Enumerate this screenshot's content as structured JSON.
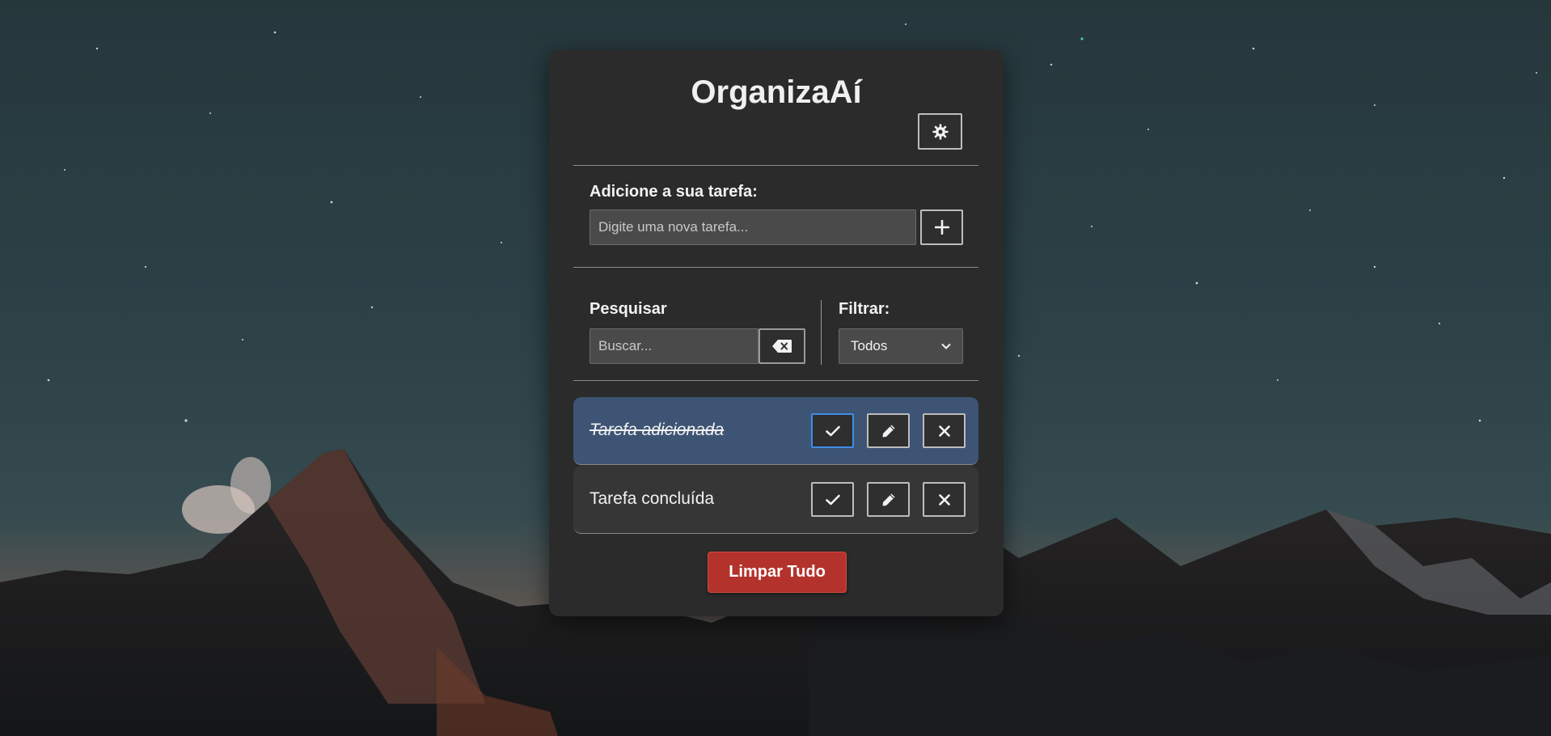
{
  "app": {
    "title": "OrganizaAí",
    "theme_toggle_icon": "gear-icon"
  },
  "add": {
    "label": "Adicione a sua tarefa:",
    "placeholder": "Digite uma nova tarefa...",
    "value": "",
    "button_icon": "plus-icon"
  },
  "search": {
    "label": "Pesquisar",
    "placeholder": "Buscar...",
    "value": "",
    "clear_icon": "backspace-icon"
  },
  "filter": {
    "label": "Filtrar:",
    "selected": "Todos"
  },
  "tasks": [
    {
      "text": "Tarefa adicionada",
      "completed": true,
      "highlight_color": "#3d5474"
    },
    {
      "text": "Tarefa concluída",
      "completed": false
    }
  ],
  "task_actions": {
    "complete_icon": "check-icon",
    "edit_icon": "pencil-icon",
    "delete_icon": "close-icon"
  },
  "clear_all": {
    "label": "Limpar Tudo",
    "color": "#b3332c"
  },
  "colors": {
    "card_bg": "#2b2b2b",
    "accent_focus": "#3f8de8"
  }
}
